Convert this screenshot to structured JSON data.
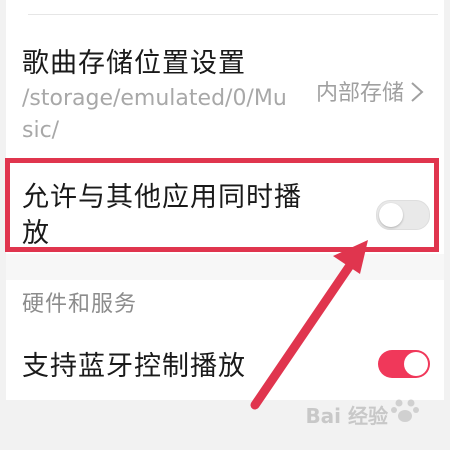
{
  "settings": {
    "storage": {
      "title": "歌曲存储位置设置",
      "path": "/storage/emulated/0/Music/",
      "value": "内部存储"
    },
    "mix_playback": {
      "label": "允许与其他应用同时播放",
      "enabled": false
    },
    "hardware_section": {
      "title": "硬件和服务"
    },
    "bluetooth_control": {
      "label": "支持蓝牙控制播放",
      "enabled": true
    }
  },
  "colors": {
    "accent": "#f0385a",
    "annotation": "#e0354e"
  },
  "watermark": {
    "text": "Bai 经验"
  }
}
